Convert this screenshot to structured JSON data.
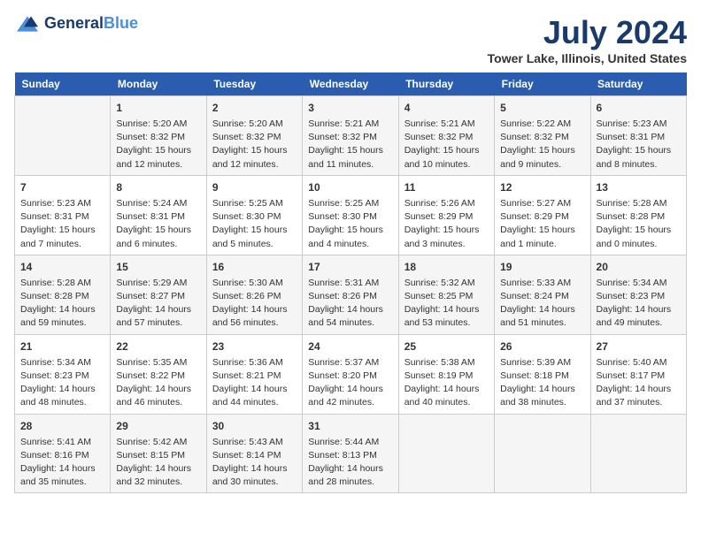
{
  "header": {
    "logo_general": "General",
    "logo_blue": "Blue",
    "month_title": "July 2024",
    "location": "Tower Lake, Illinois, United States"
  },
  "days_of_week": [
    "Sunday",
    "Monday",
    "Tuesday",
    "Wednesday",
    "Thursday",
    "Friday",
    "Saturday"
  ],
  "weeks": [
    [
      {
        "day": "",
        "info": ""
      },
      {
        "day": "1",
        "info": "Sunrise: 5:20 AM\nSunset: 8:32 PM\nDaylight: 15 hours\nand 12 minutes."
      },
      {
        "day": "2",
        "info": "Sunrise: 5:20 AM\nSunset: 8:32 PM\nDaylight: 15 hours\nand 12 minutes."
      },
      {
        "day": "3",
        "info": "Sunrise: 5:21 AM\nSunset: 8:32 PM\nDaylight: 15 hours\nand 11 minutes."
      },
      {
        "day": "4",
        "info": "Sunrise: 5:21 AM\nSunset: 8:32 PM\nDaylight: 15 hours\nand 10 minutes."
      },
      {
        "day": "5",
        "info": "Sunrise: 5:22 AM\nSunset: 8:32 PM\nDaylight: 15 hours\nand 9 minutes."
      },
      {
        "day": "6",
        "info": "Sunrise: 5:23 AM\nSunset: 8:31 PM\nDaylight: 15 hours\nand 8 minutes."
      }
    ],
    [
      {
        "day": "7",
        "info": "Sunrise: 5:23 AM\nSunset: 8:31 PM\nDaylight: 15 hours\nand 7 minutes."
      },
      {
        "day": "8",
        "info": "Sunrise: 5:24 AM\nSunset: 8:31 PM\nDaylight: 15 hours\nand 6 minutes."
      },
      {
        "day": "9",
        "info": "Sunrise: 5:25 AM\nSunset: 8:30 PM\nDaylight: 15 hours\nand 5 minutes."
      },
      {
        "day": "10",
        "info": "Sunrise: 5:25 AM\nSunset: 8:30 PM\nDaylight: 15 hours\nand 4 minutes."
      },
      {
        "day": "11",
        "info": "Sunrise: 5:26 AM\nSunset: 8:29 PM\nDaylight: 15 hours\nand 3 minutes."
      },
      {
        "day": "12",
        "info": "Sunrise: 5:27 AM\nSunset: 8:29 PM\nDaylight: 15 hours\nand 1 minute."
      },
      {
        "day": "13",
        "info": "Sunrise: 5:28 AM\nSunset: 8:28 PM\nDaylight: 15 hours\nand 0 minutes."
      }
    ],
    [
      {
        "day": "14",
        "info": "Sunrise: 5:28 AM\nSunset: 8:28 PM\nDaylight: 14 hours\nand 59 minutes."
      },
      {
        "day": "15",
        "info": "Sunrise: 5:29 AM\nSunset: 8:27 PM\nDaylight: 14 hours\nand 57 minutes."
      },
      {
        "day": "16",
        "info": "Sunrise: 5:30 AM\nSunset: 8:26 PM\nDaylight: 14 hours\nand 56 minutes."
      },
      {
        "day": "17",
        "info": "Sunrise: 5:31 AM\nSunset: 8:26 PM\nDaylight: 14 hours\nand 54 minutes."
      },
      {
        "day": "18",
        "info": "Sunrise: 5:32 AM\nSunset: 8:25 PM\nDaylight: 14 hours\nand 53 minutes."
      },
      {
        "day": "19",
        "info": "Sunrise: 5:33 AM\nSunset: 8:24 PM\nDaylight: 14 hours\nand 51 minutes."
      },
      {
        "day": "20",
        "info": "Sunrise: 5:34 AM\nSunset: 8:23 PM\nDaylight: 14 hours\nand 49 minutes."
      }
    ],
    [
      {
        "day": "21",
        "info": "Sunrise: 5:34 AM\nSunset: 8:23 PM\nDaylight: 14 hours\nand 48 minutes."
      },
      {
        "day": "22",
        "info": "Sunrise: 5:35 AM\nSunset: 8:22 PM\nDaylight: 14 hours\nand 46 minutes."
      },
      {
        "day": "23",
        "info": "Sunrise: 5:36 AM\nSunset: 8:21 PM\nDaylight: 14 hours\nand 44 minutes."
      },
      {
        "day": "24",
        "info": "Sunrise: 5:37 AM\nSunset: 8:20 PM\nDaylight: 14 hours\nand 42 minutes."
      },
      {
        "day": "25",
        "info": "Sunrise: 5:38 AM\nSunset: 8:19 PM\nDaylight: 14 hours\nand 40 minutes."
      },
      {
        "day": "26",
        "info": "Sunrise: 5:39 AM\nSunset: 8:18 PM\nDaylight: 14 hours\nand 38 minutes."
      },
      {
        "day": "27",
        "info": "Sunrise: 5:40 AM\nSunset: 8:17 PM\nDaylight: 14 hours\nand 37 minutes."
      }
    ],
    [
      {
        "day": "28",
        "info": "Sunrise: 5:41 AM\nSunset: 8:16 PM\nDaylight: 14 hours\nand 35 minutes."
      },
      {
        "day": "29",
        "info": "Sunrise: 5:42 AM\nSunset: 8:15 PM\nDaylight: 14 hours\nand 32 minutes."
      },
      {
        "day": "30",
        "info": "Sunrise: 5:43 AM\nSunset: 8:14 PM\nDaylight: 14 hours\nand 30 minutes."
      },
      {
        "day": "31",
        "info": "Sunrise: 5:44 AM\nSunset: 8:13 PM\nDaylight: 14 hours\nand 28 minutes."
      },
      {
        "day": "",
        "info": ""
      },
      {
        "day": "",
        "info": ""
      },
      {
        "day": "",
        "info": ""
      }
    ]
  ]
}
